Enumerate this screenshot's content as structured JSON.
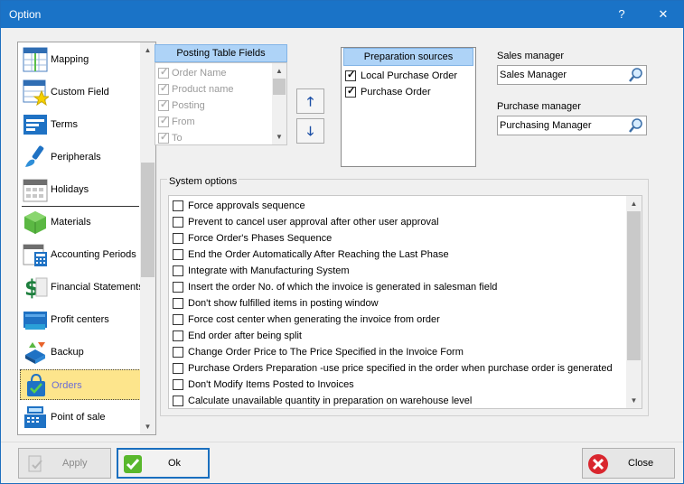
{
  "window": {
    "title": "Option",
    "help_label": "?",
    "close_label": "✕"
  },
  "sidebar": {
    "items": [
      {
        "label": "Mapping"
      },
      {
        "label": "Custom Field"
      },
      {
        "label": "Terms"
      },
      {
        "label": "Peripherals"
      },
      {
        "label": "Holidays"
      },
      {
        "label": "Materials"
      },
      {
        "label": "Accounting Periods"
      },
      {
        "label": "Financial Statements"
      },
      {
        "label": "Profit centers"
      },
      {
        "label": "Backup"
      },
      {
        "label": "Orders",
        "selected": true
      },
      {
        "label": "Point of sale"
      }
    ]
  },
  "posting_fields": {
    "header": "Posting Table Fields",
    "items": [
      {
        "label": "Order Name",
        "checked": true
      },
      {
        "label": "Product name",
        "checked": true
      },
      {
        "label": "Posting",
        "checked": true
      },
      {
        "label": "From",
        "checked": true
      },
      {
        "label": "To",
        "checked": true
      }
    ]
  },
  "move_buttons": {
    "up": "🡑",
    "down": "🡓"
  },
  "preparation_sources": {
    "header": "Preparation sources",
    "items": [
      {
        "label": "Local Purchase Order",
        "checked": true
      },
      {
        "label": "Purchase Order",
        "checked": true
      }
    ]
  },
  "sales_manager": {
    "label": "Sales manager",
    "value": "Sales Manager"
  },
  "purchase_manager": {
    "label": "Purchase manager",
    "value": "Purchasing Manager"
  },
  "system_options": {
    "title": "System options",
    "items": [
      {
        "label": "Force approvals sequence",
        "checked": false
      },
      {
        "label": "Prevent to cancel user approval after other user approval",
        "checked": false
      },
      {
        "label": "Force Order's Phases Sequence",
        "checked": false
      },
      {
        "label": "End the Order Automatically After Reaching the Last Phase",
        "checked": false
      },
      {
        "label": "Integrate with Manufacturing System",
        "checked": false
      },
      {
        "label": "Insert the order No. of which the invoice is generated in salesman field",
        "checked": false
      },
      {
        "label": "Don't show fulfilled items in posting window",
        "checked": false
      },
      {
        "label": "Force cost center when generating the invoice from  order",
        "checked": false
      },
      {
        "label": "End order after being split",
        "checked": false
      },
      {
        "label": "Change Order Price to The Price Specified in the Invoice Form",
        "checked": false
      },
      {
        "label": "Purchase Orders Preparation -use price specified in the order when purchase order is generated",
        "checked": false
      },
      {
        "label": "Don't Modify Items Posted to Invoices",
        "checked": false
      },
      {
        "label": "Calculate unavailable quantity in preparation on warehouse level",
        "checked": false
      }
    ]
  },
  "footer": {
    "apply_label": "Apply",
    "ok_label": "Ok",
    "close_label": "Close"
  },
  "colors": {
    "titlebar": "#1a73c7",
    "selected_item": "#fde58c",
    "group_header": "#aed3f7"
  }
}
